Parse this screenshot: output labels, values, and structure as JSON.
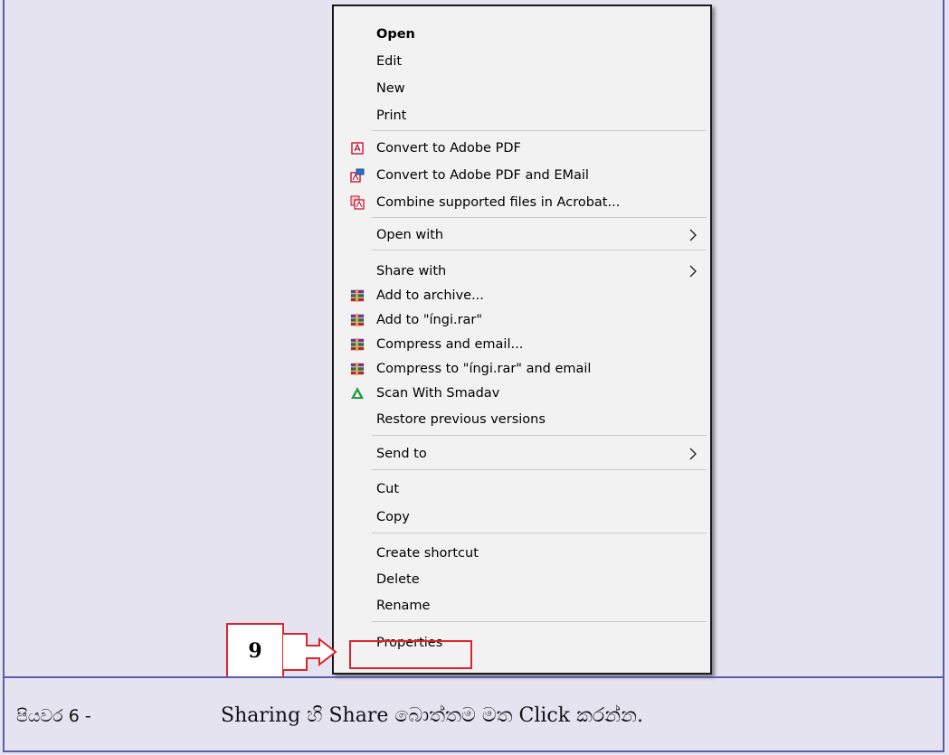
{
  "menu": {
    "items": [
      {
        "label": "Open",
        "icon": "",
        "bold": true,
        "submenu": false
      },
      {
        "label": "Edit",
        "icon": "",
        "bold": false,
        "submenu": false
      },
      {
        "label": "New",
        "icon": "",
        "bold": false,
        "submenu": false
      },
      {
        "label": "Print",
        "icon": "",
        "bold": false,
        "submenu": false
      },
      {
        "label": "Convert to Adobe PDF",
        "icon": "adobe-pdf-icon",
        "bold": false,
        "submenu": false
      },
      {
        "label": "Convert to Adobe PDF and EMail",
        "icon": "adobe-pdf-email-icon",
        "bold": false,
        "submenu": false
      },
      {
        "label": "Combine supported files in Acrobat...",
        "icon": "acrobat-combine-icon",
        "bold": false,
        "submenu": false
      },
      {
        "label": "Open with",
        "icon": "",
        "bold": false,
        "submenu": true
      },
      {
        "label": "Share with",
        "icon": "",
        "bold": false,
        "submenu": true
      },
      {
        "label": "Add to archive...",
        "icon": "winrar-icon",
        "bold": false,
        "submenu": false
      },
      {
        "label": "Add to \"íngi.rar\"",
        "icon": "winrar-icon",
        "bold": false,
        "submenu": false
      },
      {
        "label": "Compress and email...",
        "icon": "winrar-icon",
        "bold": false,
        "submenu": false
      },
      {
        "label": "Compress to \"íngi.rar\" and email",
        "icon": "winrar-icon",
        "bold": false,
        "submenu": false
      },
      {
        "label": "Scan With Smadav",
        "icon": "smadav-icon",
        "bold": false,
        "submenu": false
      },
      {
        "label": "Restore previous versions",
        "icon": "",
        "bold": false,
        "submenu": false
      },
      {
        "label": "Send to",
        "icon": "",
        "bold": false,
        "submenu": true
      },
      {
        "label": "Cut",
        "icon": "",
        "bold": false,
        "submenu": false
      },
      {
        "label": "Copy",
        "icon": "",
        "bold": false,
        "submenu": false
      },
      {
        "label": "Create shortcut",
        "icon": "",
        "bold": false,
        "submenu": false
      },
      {
        "label": "Delete",
        "icon": "",
        "bold": false,
        "submenu": false
      },
      {
        "label": "Rename",
        "icon": "",
        "bold": false,
        "submenu": false
      },
      {
        "label": "Properties",
        "icon": "",
        "bold": false,
        "submenu": false
      }
    ]
  },
  "callout": {
    "number": "9"
  },
  "step": {
    "label": "පියවර 6 -",
    "text": "Sharing හි Share බොත්තම මත Click කරන්න."
  },
  "colors": {
    "background": "#e6e3f1",
    "frame_border": "#5a5ea8",
    "highlight": "#d8262e",
    "menu_bg": "#f2f2f2"
  }
}
